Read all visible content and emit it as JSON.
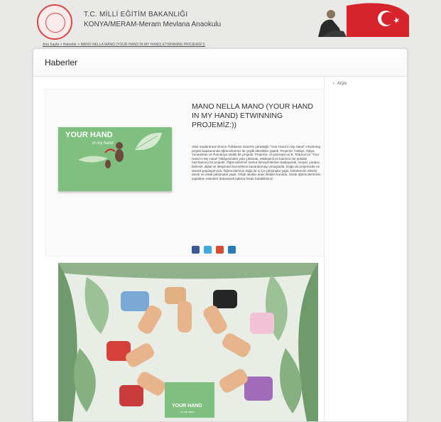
{
  "header": {
    "ministry": "T.C. MİLLİ EĞİTİM BAKANLIĞI",
    "school": "KONYA/MERAM-Meram Mevlana Anaokulu"
  },
  "breadcrumb": "Ana Sayfa > Haberler > MANO NELLA MANO (YOUR HAND IN MY HAND) ETWINNING PROJEMİZ:))",
  "page": {
    "title": "Haberler"
  },
  "sidebar": {
    "archive": "Arşiv"
  },
  "article": {
    "title": "MANO NELLA MANO (YOUR HAND IN MY HAND) ETWINNING PROJEMİZ:))",
    "body": "Okul müdürümüz Emine Türkkesin Güzel'in yürüttüğü \"Your Hand in My Hand\" eTwinning projesi kapsamında öğrencilerimiz ile çeşitli etkinlikler yaptık. Projemiz Türkiye, İtalya, Yunanistan ve Romanya ortaklı bir projedir. Projemiz, el yazısıyla ve B. Todorov'un \"Your Hand in My Hand\" hikâyesinden yola çıkılarak, etkileşimli ve katılımcı bir şekilde hazırlanmış bir projedir. Öğrencilerimiz somut deneyimlerden başlayarak, sosyal, yaratıcı, bilimsel, dijital ve iletişimsel becerilerini kazandırmayı amaçladık. Doğa da projemizde en önemli paydaşımızdı. Öğrencilerimiz doğa ile iç içe çalışmalar yaptı, birbirlerinin ellerini tanıdı ve ortak çalışmalar yaptı. Ortak okullar arası iletişim kuruldu. Sizde öğrencilerimizin yaptıkları resimleri dokunarak bakma fırsatı bulabilirsiniz.",
    "thumb_title": "YOUR HAND",
    "thumb_sub": "in my hand",
    "photo_caption": "YOUR HAND",
    "photo_sub": "in my hand"
  },
  "share": [
    "facebook-icon",
    "twitter-icon",
    "google-plus-icon",
    "linkedin-icon"
  ],
  "colors": {
    "facebook": "#3b5998",
    "twitter": "#3fa9e0",
    "google": "#d84b37",
    "linkedin": "#2d7ab8",
    "thumb_green": "#7fbf7f"
  }
}
